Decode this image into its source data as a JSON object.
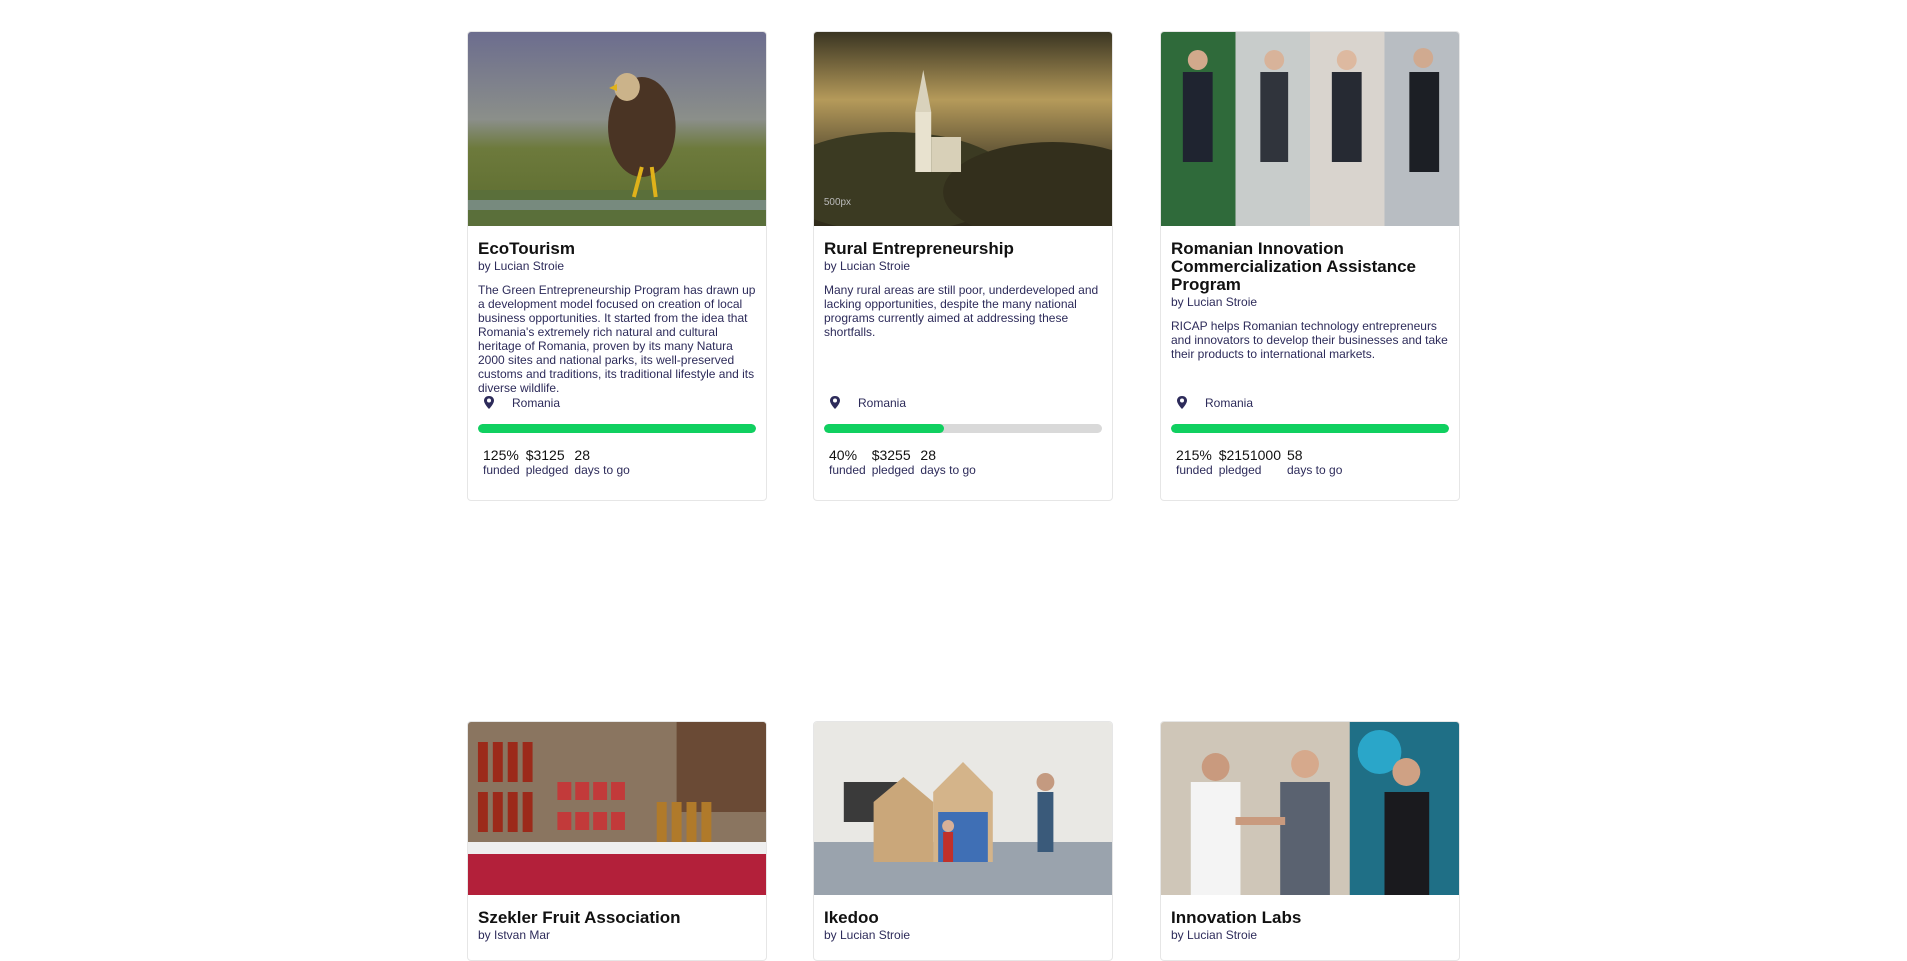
{
  "colors": {
    "progress_fill": "#10d060",
    "progress_track": "#d9d9d9",
    "text_primary": "#111111",
    "text_secondary": "#2d2b5a"
  },
  "projects": [
    {
      "title": "EcoTourism",
      "byline": "by Lucian Stroie",
      "description": "The Green Entrepreneurship Program has drawn up a development model focused on creation of local business opportunities. It started from the idea that Romania's extremely rich natural and cultural heritage of Romania, proven by its many Natura 2000 sites and national parks, its well-preserved customs and traditions, its traditional lifestyle and its diverse wildlife.",
      "location": "Romania",
      "location_icon": "map-pin-icon",
      "progress_fraction": 1.0,
      "funded_value": "125%",
      "funded_label": "funded",
      "pledged_value": "$3125",
      "pledged_label": "pledged",
      "days_value": "28",
      "days_label": "days to go",
      "image_subject": "eagle-photo"
    },
    {
      "title": "Rural Entrepreneurship",
      "byline": "by Lucian Stroie",
      "description": "Many rural areas are still poor, underdeveloped and lacking opportunities, despite the many national programs currently aimed at addressing these shortfalls.",
      "location": "Romania",
      "location_icon": "map-pin-icon",
      "progress_fraction": 0.43,
      "funded_value": "40%",
      "funded_label": "funded",
      "pledged_value": "$3255",
      "pledged_label": "pledged",
      "days_value": "28",
      "days_label": "days to go",
      "image_subject": "village-church-photo",
      "image_watermark": "500px"
    },
    {
      "title": "Romanian Innovation Commercialization Assistance Program",
      "byline": "by Lucian Stroie",
      "description": "RICAP helps Romanian technology entrepreneurs and innovators to develop their businesses and take their products to international markets.",
      "location": "Romania",
      "location_icon": "map-pin-icon",
      "progress_fraction": 1.0,
      "funded_value": "215%",
      "funded_label": "funded",
      "pledged_value": "$2151000",
      "pledged_label": "pledged",
      "days_value": "58",
      "days_label": "days to go",
      "image_subject": "exoskeleton-collage-photo"
    },
    {
      "title": "Szekler Fruit Association",
      "byline": "by Istvan Mar",
      "image_subject": "jam-jars-market-photo"
    },
    {
      "title": "Ikedoo",
      "byline": "by Lucian Stroie",
      "image_subject": "kids-playhouse-photo"
    },
    {
      "title": "Innovation Labs",
      "byline": "by Lucian Stroie",
      "image_subject": "handshake-event-photo"
    }
  ]
}
